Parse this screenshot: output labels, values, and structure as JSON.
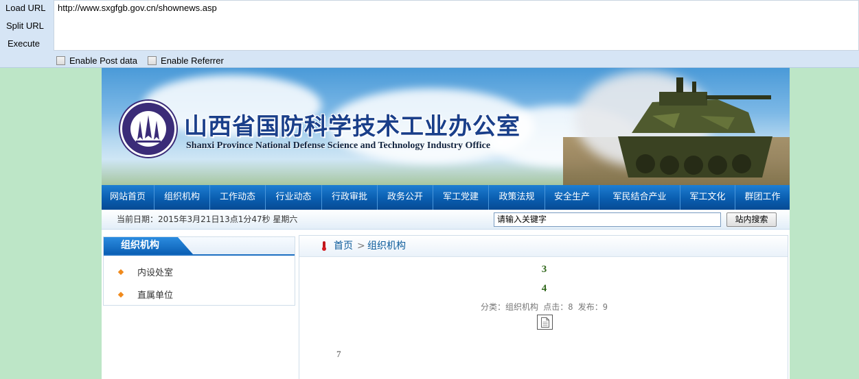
{
  "hackbar": {
    "commands": [
      "Load URL",
      "Split URL",
      "Execute"
    ],
    "url": "http://www.sxgfgb.gov.cn/shownews.asp",
    "options": [
      "Enable Post data",
      "Enable Referrer"
    ]
  },
  "site": {
    "title_cn": "山西省国防科学技术工业办公室",
    "title_en": "Shanxi Province National Defense Science and Technology Industry Office",
    "nav": [
      "网站首页",
      "组织机构",
      "工作动态",
      "行业动态",
      "行政审批",
      "政务公开",
      "军工党建",
      "政策法规",
      "安全生产",
      "军民结合产业",
      "军工文化",
      "群团工作"
    ],
    "date_text": "当前日期：2015年3月21日13点1分47秒  星期六",
    "search": {
      "value": "请输入关键字",
      "button": "站内搜索"
    },
    "sidebar": {
      "title": "组织机构",
      "items": [
        "内设处室",
        "直属单位"
      ]
    },
    "breadcrumb": {
      "home": "首页",
      "separator": ">",
      "current": "组织机构"
    },
    "article": {
      "line1": "3",
      "line2": "4",
      "meta": "分类：组织机构 点击：8 发布：9",
      "body": "7"
    }
  },
  "colors": {
    "page_bg": "#bde6c7",
    "nav_blue": "#0a5eb0",
    "accent_orange": "#f08a1c",
    "title_blue": "#1a3f8a"
  }
}
